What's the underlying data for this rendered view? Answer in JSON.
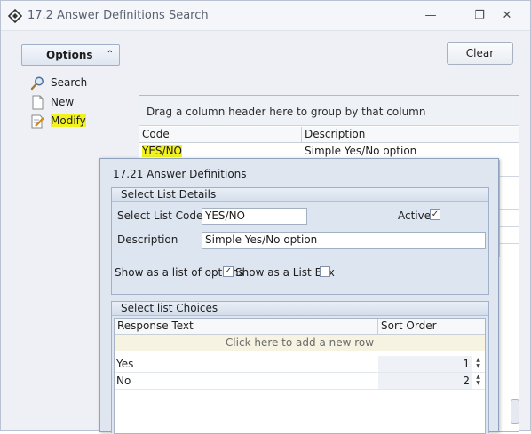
{
  "window": {
    "title": "17.2 Answer Definitions Search",
    "controls": {
      "minimize": "—",
      "restore": "❐",
      "close": "✕"
    }
  },
  "options": {
    "label": "Options",
    "chevron": "⌃"
  },
  "clear_button": {
    "label": "Clear"
  },
  "nav": {
    "items": [
      {
        "label": "Search",
        "icon": "search-icon"
      },
      {
        "label": "New",
        "icon": "new-document-icon"
      },
      {
        "label": "Modify",
        "icon": "edit-document-icon"
      }
    ]
  },
  "grid": {
    "group_hint": "Drag a column header here to group by that column",
    "columns": [
      "Code",
      "Description"
    ],
    "rows": [
      {
        "code": "YES/NO",
        "description": "Simple Yes/No option"
      }
    ]
  },
  "dialog": {
    "title": "17.21 Answer Definitions",
    "details": {
      "caption": "Select List Details",
      "code_label": "Select List Code",
      "code_value": "YES/NO",
      "active_label": "Active",
      "active_checked": "✓",
      "description_label": "Description",
      "description_value": "Simple Yes/No option",
      "show_list_label": "Show as a list of options",
      "show_list_checked": "✓",
      "show_listbox_label": "Show as a List Box"
    },
    "choices": {
      "caption": "Select list Choices",
      "columns": [
        "Response Text",
        "Sort Order"
      ],
      "add_row": "Click here to add a new row",
      "rows": [
        {
          "text": "Yes",
          "order": "1"
        },
        {
          "text": "No",
          "order": "2"
        }
      ]
    }
  },
  "colors": {
    "highlight": "#f2f21e",
    "accent": "#9fb1cb"
  }
}
